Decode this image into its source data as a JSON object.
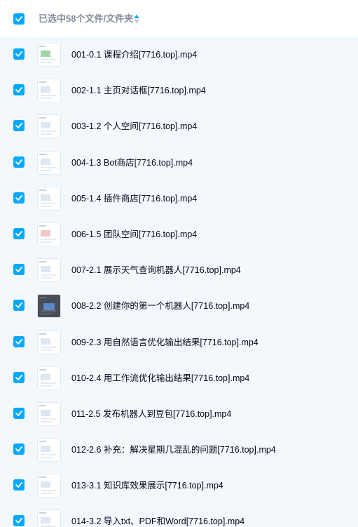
{
  "header": {
    "selected_label": "已选中58个文件/文件夹"
  },
  "files": [
    {
      "name": "001-0.1 课程介绍[7716.top].mp4",
      "thumb": "color1"
    },
    {
      "name": "002-1.1 主页对话框[7716.top].mp4",
      "thumb": ""
    },
    {
      "name": "003-1.2 个人空间[7716.top].mp4",
      "thumb": ""
    },
    {
      "name": "004-1.3 Bot商店[7716.top].mp4",
      "thumb": ""
    },
    {
      "name": "005-1.4 插件商店[7716.top].mp4",
      "thumb": ""
    },
    {
      "name": "006-1.5 团队空间[7716.top].mp4",
      "thumb": "color2"
    },
    {
      "name": "007-2.1 展示天气查询机器人[7716.top].mp4",
      "thumb": ""
    },
    {
      "name": "008-2.2 创建你的第一个机器人[7716.top].mp4",
      "thumb": "dark"
    },
    {
      "name": "009-2.3 用自然语言优化输出结果[7716.top].mp4",
      "thumb": ""
    },
    {
      "name": "010-2.4 用工作流优化输出结果[7716.top].mp4",
      "thumb": ""
    },
    {
      "name": "011-2.5 发布机器人到豆包[7716.top].mp4",
      "thumb": ""
    },
    {
      "name": "012-2.6 补充：解决星期几混乱的问题[7716.top].mp4",
      "thumb": ""
    },
    {
      "name": "013-3.1 知识库效果展示[7716.top].mp4",
      "thumb": ""
    },
    {
      "name": "014-3.2 导入txt、PDF和Word[7716.top].mp4",
      "thumb": ""
    }
  ]
}
